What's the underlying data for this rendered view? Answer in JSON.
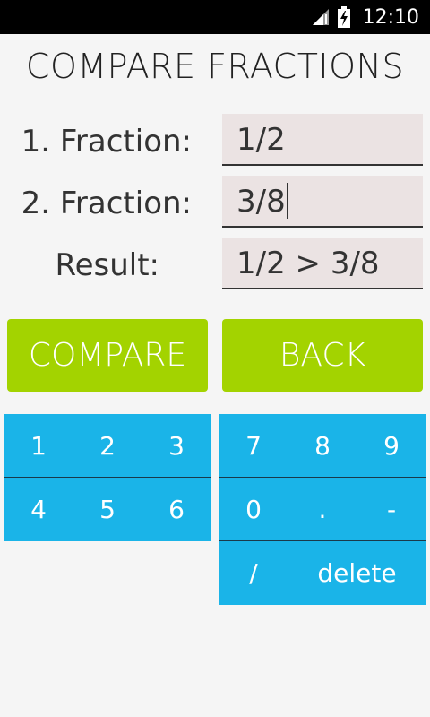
{
  "status_bar": {
    "time": "12:10",
    "icons": [
      "signal-icon",
      "battery-charging-icon"
    ]
  },
  "title": "COMPARE FRACTIONS",
  "form": {
    "fraction1_label": "1. Fraction:",
    "fraction1_value": "1/2",
    "fraction2_label": "2. Fraction:",
    "fraction2_value": "3/8",
    "result_label": "Result:",
    "result_value": "1/2 > 3/8"
  },
  "buttons": {
    "compare": "COMPARE",
    "back": "BACK"
  },
  "keypad": {
    "left": [
      "1",
      "2",
      "3",
      "4",
      "5",
      "6"
    ],
    "right": [
      "7",
      "8",
      "9",
      "0",
      ".",
      "-",
      "/",
      "delete"
    ]
  },
  "colors": {
    "accent_green": "#a3d300",
    "keypad_blue": "#1ab4e8",
    "field_bg": "#ebe3e3"
  }
}
